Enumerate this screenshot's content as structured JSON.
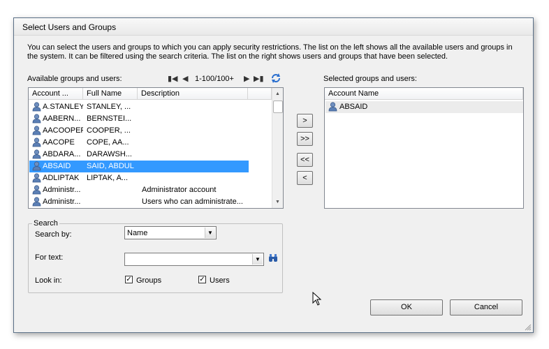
{
  "window": {
    "title": "Select Users and Groups"
  },
  "description": "You can select the users and groups to which you can apply security restrictions. The list on the left shows all the available users and groups in the system.  It can be filtered using the search criteria. The list on the right shows users and groups that have been selected.",
  "available": {
    "label": "Available groups and users:",
    "pager": {
      "range": "1-100/100+"
    },
    "columns": [
      "Account ...",
      "Full Name",
      "Description"
    ],
    "rows": [
      {
        "account": "A.STANLEY",
        "fullname": "STANLEY, ...",
        "description": ""
      },
      {
        "account": "AABERN...",
        "fullname": "BERNSTEI...",
        "description": ""
      },
      {
        "account": "AACOOPER",
        "fullname": "COOPER, ...",
        "description": ""
      },
      {
        "account": "AACOPE",
        "fullname": "COPE, AA...",
        "description": ""
      },
      {
        "account": "ABDARA...",
        "fullname": "DARAWSH...",
        "description": ""
      },
      {
        "account": "ABSAID",
        "fullname": "SAID, ABDUL",
        "description": ""
      },
      {
        "account": "ADLIPTAK",
        "fullname": "LIPTAK, A...",
        "description": ""
      },
      {
        "account": "Administr...",
        "fullname": "",
        "description": "Administrator account"
      },
      {
        "account": "Administr...",
        "fullname": "",
        "description": "Users who can administrate..."
      }
    ],
    "selected_index": 5
  },
  "transfer": {
    "add": ">",
    "add_all": ">>",
    "remove_all": "<<",
    "remove": "<"
  },
  "selected": {
    "label": "Selected groups and users:",
    "column": "Account Name",
    "rows": [
      {
        "account": "ABSAID"
      }
    ]
  },
  "search": {
    "legend": "Search",
    "search_by_label": "Search by:",
    "search_by_value": "Name",
    "for_text_label": "For text:",
    "for_text_value": "",
    "look_in_label": "Look in:",
    "groups_label": "Groups",
    "groups_checked": true,
    "users_label": "Users",
    "users_checked": true
  },
  "buttons": {
    "ok": "OK",
    "cancel": "Cancel"
  },
  "colors": {
    "selection": "#3399ff",
    "dialog_bg": "#f0f0f0",
    "list_border": "#828790"
  }
}
